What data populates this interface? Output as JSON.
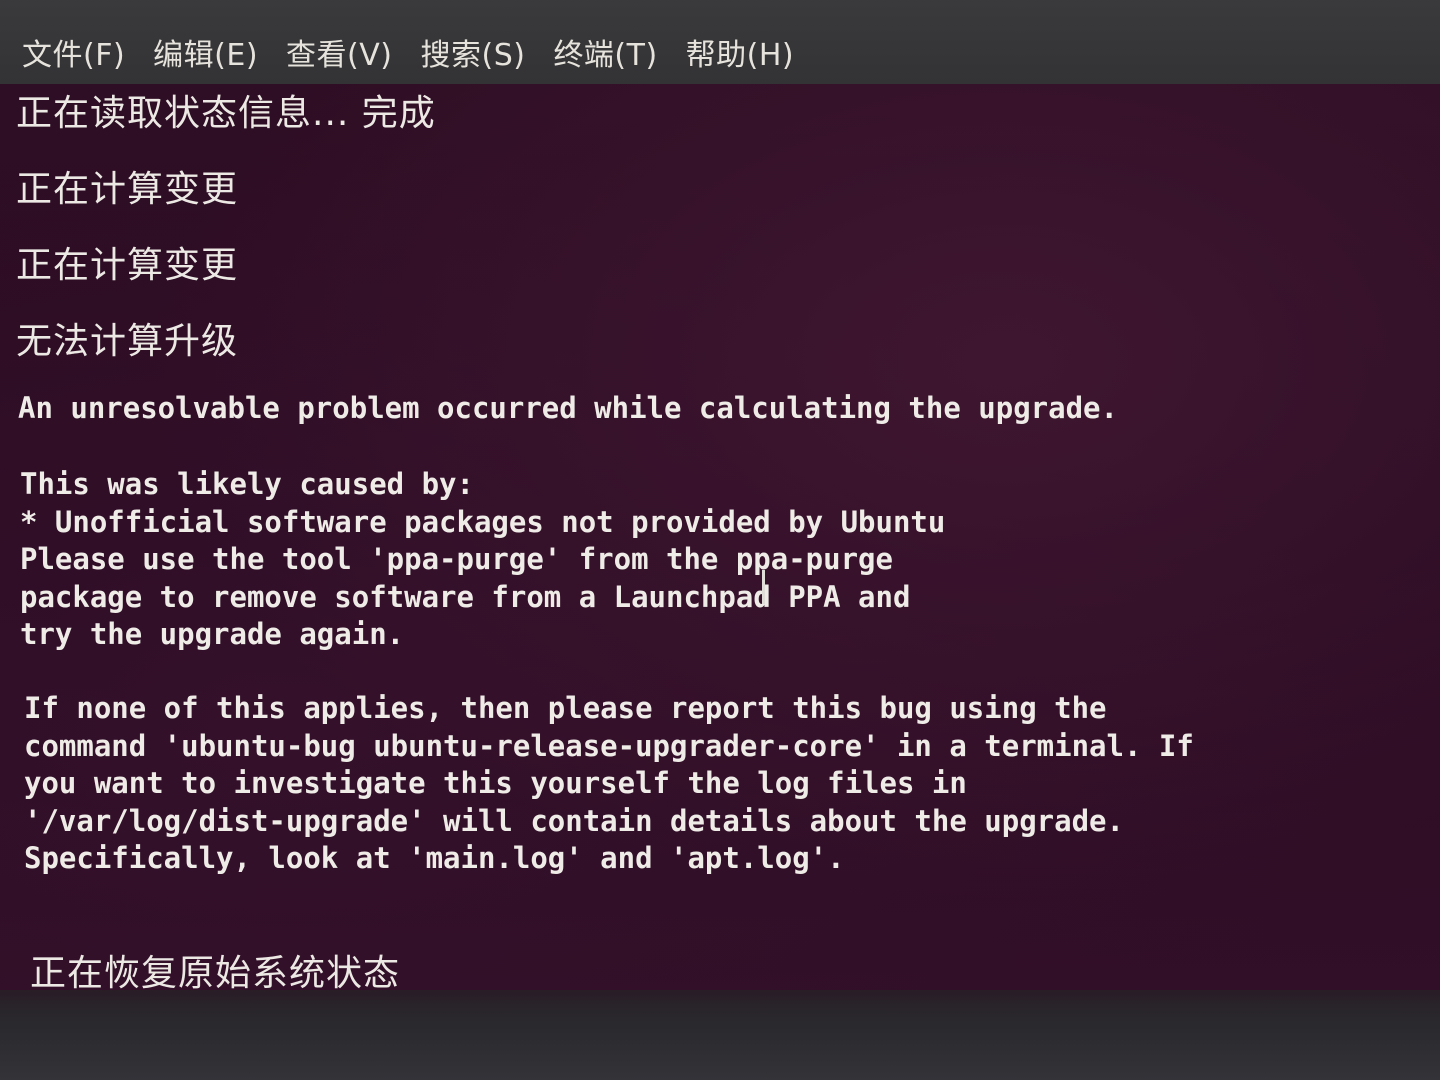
{
  "menubar": {
    "items": [
      {
        "label": "文件(F)"
      },
      {
        "label": "编辑(E)"
      },
      {
        "label": "查看(V)"
      },
      {
        "label": "搜索(S)"
      },
      {
        "label": "终端(T)"
      },
      {
        "label": "帮助(H)"
      }
    ]
  },
  "terminal": {
    "status_lines": [
      "正在读取状态信息... 完成",
      "正在计算变更",
      "正在计算变更",
      "无法计算升级"
    ],
    "error_line": "An unresolvable problem occurred while calculating the upgrade.",
    "cause_lines": [
      "This was likely caused by:",
      "* Unofficial software packages not provided by Ubuntu",
      "Please use the tool 'ppa-purge' from the ppa-purge",
      "package to remove software from a Launchpad PPA and",
      "try the upgrade again."
    ],
    "report_lines": [
      "If none of this applies, then please report this bug using the",
      "command 'ubuntu-bug ubuntu-release-upgrader-core' in a terminal. If",
      "you want to investigate this yourself the log files in",
      "'/var/log/dist-upgrade' will contain details about the upgrade.",
      "Specifically, look at 'main.log' and 'apt.log'."
    ],
    "final_line": "正在恢复原始系统状态"
  }
}
